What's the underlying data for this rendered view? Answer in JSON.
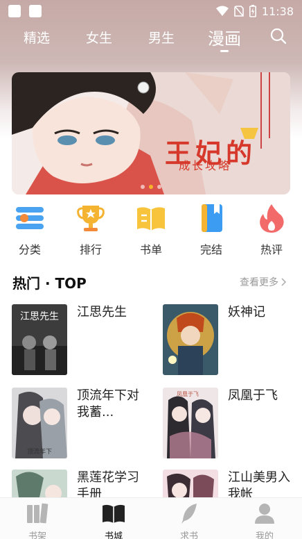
{
  "status_bar": {
    "time": "11:38"
  },
  "nav": {
    "tabs": [
      {
        "label": "精选",
        "active": false
      },
      {
        "label": "女生",
        "active": false
      },
      {
        "label": "男生",
        "active": false
      },
      {
        "label": "漫画",
        "active": true
      }
    ],
    "search_icon": "search-icon"
  },
  "banner": {
    "title": "王妃的",
    "subtitle": "成长攻略",
    "pages": 3,
    "current": 2
  },
  "categories": [
    {
      "label": "分类",
      "icon": "list-icon",
      "color": "#4aa3f0"
    },
    {
      "label": "排行",
      "icon": "trophy-icon",
      "color": "#f5b332"
    },
    {
      "label": "书单",
      "icon": "open-book-icon",
      "color": "#f7c43b"
    },
    {
      "label": "完结",
      "icon": "bookmark-book-icon",
      "color": "#3b9cf2"
    },
    {
      "label": "热评",
      "icon": "flame-icon",
      "color": "#f36a6a"
    }
  ],
  "section": {
    "title": "热门 · TOP",
    "more": "查看更多"
  },
  "books": [
    {
      "title": "江思先生"
    },
    {
      "title": "妖神记"
    },
    {
      "title": "顶流年下对我蓄..."
    },
    {
      "title": "凤凰于飞"
    },
    {
      "title": "黑莲花学习手册"
    },
    {
      "title": "江山美男入我帐"
    }
  ],
  "tabbar": [
    {
      "label": "书架",
      "icon": "bookshelf-icon",
      "active": false
    },
    {
      "label": "书城",
      "icon": "open-book-icon",
      "active": true
    },
    {
      "label": "求书",
      "icon": "feather-icon",
      "active": false
    },
    {
      "label": "我的",
      "icon": "person-icon",
      "active": false
    }
  ]
}
